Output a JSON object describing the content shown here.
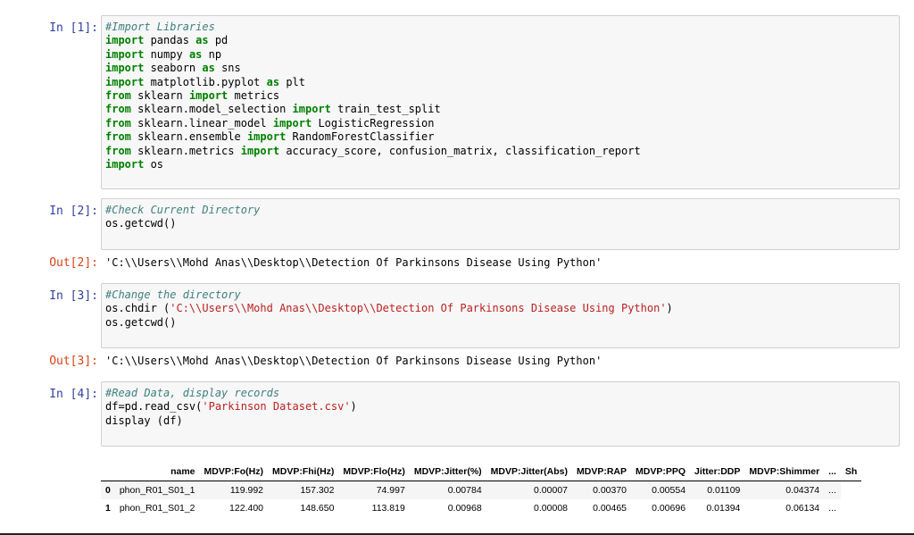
{
  "cells": [
    {
      "prompt": "In [1]:",
      "lines": [
        [
          {
            "t": "cm",
            "v": "#Import Libraries"
          }
        ],
        [
          {
            "t": "kw",
            "v": "import"
          },
          {
            "t": "n",
            "v": " pandas "
          },
          {
            "t": "kw",
            "v": "as"
          },
          {
            "t": "n",
            "v": " pd"
          }
        ],
        [
          {
            "t": "kw",
            "v": "import"
          },
          {
            "t": "n",
            "v": " numpy "
          },
          {
            "t": "kw",
            "v": "as"
          },
          {
            "t": "n",
            "v": " np"
          }
        ],
        [
          {
            "t": "kw",
            "v": "import"
          },
          {
            "t": "n",
            "v": " seaborn "
          },
          {
            "t": "kw",
            "v": "as"
          },
          {
            "t": "n",
            "v": " sns"
          }
        ],
        [
          {
            "t": "kw",
            "v": "import"
          },
          {
            "t": "n",
            "v": " matplotlib.pyplot "
          },
          {
            "t": "kw",
            "v": "as"
          },
          {
            "t": "n",
            "v": " plt"
          }
        ],
        [
          {
            "t": "kw",
            "v": "from"
          },
          {
            "t": "n",
            "v": " sklearn "
          },
          {
            "t": "kw",
            "v": "import"
          },
          {
            "t": "n",
            "v": " metrics"
          }
        ],
        [
          {
            "t": "kw",
            "v": "from"
          },
          {
            "t": "n",
            "v": " sklearn.model_selection "
          },
          {
            "t": "kw",
            "v": "import"
          },
          {
            "t": "n",
            "v": " train_test_split"
          }
        ],
        [
          {
            "t": "kw",
            "v": "from"
          },
          {
            "t": "n",
            "v": " sklearn.linear_model "
          },
          {
            "t": "kw",
            "v": "import"
          },
          {
            "t": "n",
            "v": " LogisticRegression"
          }
        ],
        [
          {
            "t": "kw",
            "v": "from"
          },
          {
            "t": "n",
            "v": " sklearn.ensemble "
          },
          {
            "t": "kw",
            "v": "import"
          },
          {
            "t": "n",
            "v": " RandomForestClassifier"
          }
        ],
        [
          {
            "t": "kw",
            "v": "from"
          },
          {
            "t": "n",
            "v": " sklearn.metrics "
          },
          {
            "t": "kw",
            "v": "import"
          },
          {
            "t": "n",
            "v": " accuracy_score, confusion_matrix, classification_report"
          }
        ],
        [
          {
            "t": "kw",
            "v": "import"
          },
          {
            "t": "n",
            "v": " os"
          }
        ]
      ]
    },
    {
      "prompt": "In [2]:",
      "lines": [
        [
          {
            "t": "cm",
            "v": "#Check Current Directory"
          }
        ],
        [
          {
            "t": "n",
            "v": "os.getcwd()"
          }
        ]
      ],
      "out_prompt": "Out[2]:",
      "output": "'C:\\\\Users\\\\Mohd Anas\\\\Desktop\\\\Detection Of Parkinsons Disease Using Python'"
    },
    {
      "prompt": "In [3]:",
      "lines": [
        [
          {
            "t": "cm",
            "v": "#Change the directory"
          }
        ],
        [
          {
            "t": "n",
            "v": "os.chdir ("
          },
          {
            "t": "st",
            "v": "'C:\\\\Users\\\\Mohd Anas\\\\Desktop\\\\Detection Of Parkinsons Disease Using Python'"
          },
          {
            "t": "n",
            "v": ")"
          }
        ],
        [
          {
            "t": "n",
            "v": "os.getcwd()"
          }
        ]
      ],
      "out_prompt": "Out[3]:",
      "output": "'C:\\\\Users\\\\Mohd Anas\\\\Desktop\\\\Detection Of Parkinsons Disease Using Python'"
    },
    {
      "prompt": "In [4]:",
      "lines": [
        [
          {
            "t": "cm",
            "v": "#Read Data, display records"
          }
        ],
        [
          {
            "t": "n",
            "v": "df=pd.read_csv("
          },
          {
            "t": "st",
            "v": "'Parkinson Dataset.csv'"
          },
          {
            "t": "n",
            "v": ")"
          }
        ],
        [
          {
            "t": "n",
            "v": "display (df)"
          }
        ]
      ]
    }
  ],
  "table": {
    "columns": [
      "",
      "name",
      "MDVP:Fo(Hz)",
      "MDVP:Fhi(Hz)",
      "MDVP:Flo(Hz)",
      "MDVP:Jitter(%)",
      "MDVP:Jitter(Abs)",
      "MDVP:RAP",
      "MDVP:PPQ",
      "Jitter:DDP",
      "MDVP:Shimmer",
      "...",
      "Sh"
    ],
    "rows": [
      [
        "0",
        "phon_R01_S01_1",
        "119.992",
        "157.302",
        "74.997",
        "0.00784",
        "0.00007",
        "0.00370",
        "0.00554",
        "0.01109",
        "0.04374",
        "..."
      ],
      [
        "1",
        "phon_R01_S01_2",
        "122.400",
        "148.650",
        "113.819",
        "0.00968",
        "0.00008",
        "0.00465",
        "0.00696",
        "0.01394",
        "0.06134",
        "..."
      ]
    ]
  }
}
